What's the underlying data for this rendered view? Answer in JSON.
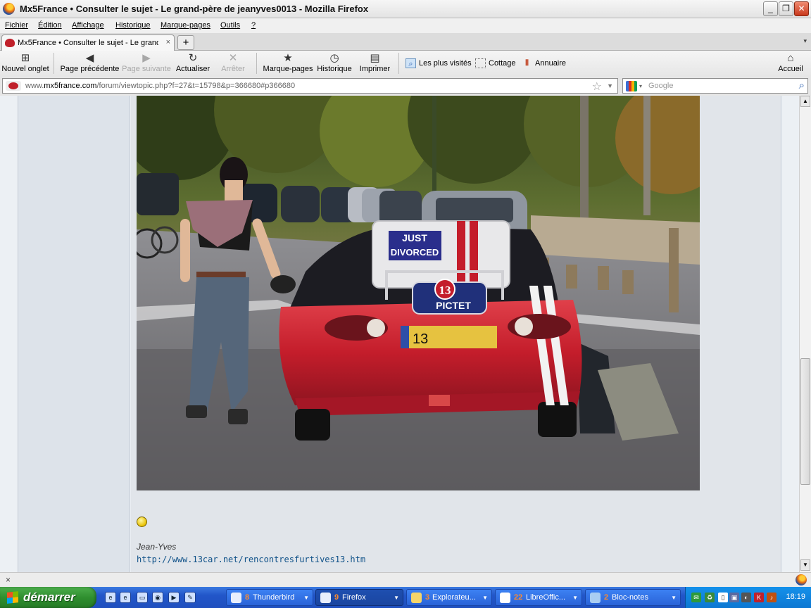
{
  "window": {
    "title": "Mx5France • Consulter le sujet - Le grand-père de jeanyves0013 - Mozilla Firefox",
    "minimize": "_",
    "restore": "❐",
    "close": "✕"
  },
  "menu": {
    "items": [
      "Fichier",
      "Édition",
      "Affichage",
      "Historique",
      "Marque-pages",
      "Outils",
      "?"
    ]
  },
  "tabs": {
    "active_label": "Mx5France • Consulter le sujet - Le grand-p...",
    "close_glyph": "×",
    "new_tab_glyph": "+",
    "list_glyph": "▾"
  },
  "toolbar": {
    "new_tab": "Nouvel onglet",
    "back": "Page précédente",
    "forward": "Page suivante",
    "reload": "Actualiser",
    "stop": "Arrêter",
    "bookmarks": "Marque-pages",
    "history": "Historique",
    "print": "Imprimer",
    "home": "Accueil"
  },
  "bookmarks_bar": {
    "most_visited": "Les plus visités",
    "cottage": "Cottage",
    "directory": "Annuaire"
  },
  "address": {
    "url_prefix": "www.",
    "url_domain": "mx5france.com",
    "url_path": "/forum/viewtopic.php?f=27&t=15798&p=366680#p366680"
  },
  "search": {
    "placeholder": "Google"
  },
  "post": {
    "signature_name": "Jean-Yves",
    "signature_link": "http://www.13car.net/rencontresfurtives13.htm",
    "photo": {
      "sign_line1": "JUST",
      "sign_line2": "DIVORCED",
      "badge_number": "13",
      "badge_text": "PICTET",
      "plate_text": "13"
    }
  },
  "statusbar": {
    "close_glyph": "×"
  },
  "taskbar": {
    "start_label": "démarrer",
    "tasks": [
      {
        "count": "8",
        "name": "Thunderbird"
      },
      {
        "count": "9",
        "name": "Firefox"
      },
      {
        "count": "3",
        "name": "Explorateu..."
      },
      {
        "count": "22",
        "name": "LibreOffic..."
      },
      {
        "count": "2",
        "name": "Bloc-notes"
      }
    ],
    "clock": "18:19"
  },
  "colors": {
    "accent_blue": "#2256c9",
    "start_green": "#2f8f2f",
    "link_blue": "#105289",
    "car_red": "#c8202c"
  }
}
